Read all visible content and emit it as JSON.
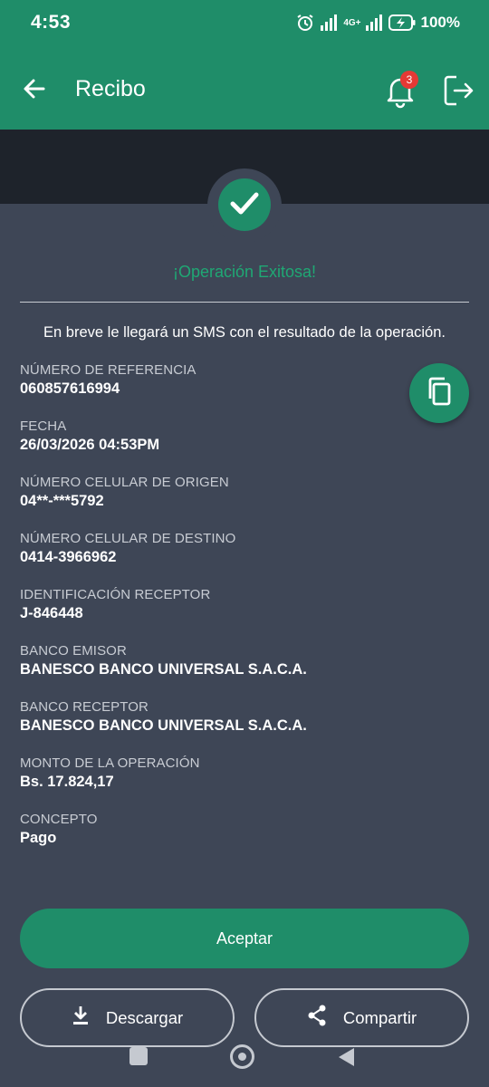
{
  "status_bar": {
    "time": "4:53",
    "network": "4G+",
    "battery": "100%",
    "icons": [
      "alarm-icon",
      "signal-icon",
      "signal-icon",
      "battery-charging-icon"
    ]
  },
  "app_bar": {
    "title": "Recibo",
    "notification_count": "3",
    "icons": [
      "back-arrow-icon",
      "bell-icon",
      "logout-icon"
    ]
  },
  "result": {
    "title": "¡Operación Exitosa!",
    "sms_note": "En breve le llegará un SMS con el resultado de la operación."
  },
  "fields": [
    {
      "label": "NÚMERO DE REFERENCIA",
      "value": "060857616994"
    },
    {
      "label": "FECHA",
      "value": "26/03/2026 04:53PM"
    },
    {
      "label": "NÚMERO CELULAR DE ORIGEN",
      "value": "04**-***5792"
    },
    {
      "label": "NÚMERO CELULAR DE DESTINO",
      "value": "0414-3966962"
    },
    {
      "label": "IDENTIFICACIÓN RECEPTOR",
      "value": "J-846448"
    },
    {
      "label": "BANCO EMISOR",
      "value": "BANESCO BANCO UNIVERSAL S.A.C.A."
    },
    {
      "label": "BANCO RECEPTOR",
      "value": "BANESCO BANCO UNIVERSAL S.A.C.A."
    },
    {
      "label": "MONTO DE LA OPERACIÓN",
      "value": "Bs. 17.824,17"
    },
    {
      "label": "CONCEPTO",
      "value": "Pago"
    }
  ],
  "actions": {
    "accept": "Aceptar",
    "download": "Descargar",
    "share": "Compartir"
  },
  "colors": {
    "primary": "#1f8d69",
    "background": "#3e4656",
    "band": "#1e232b",
    "success_text": "#1fa874",
    "badge": "#e53935"
  }
}
